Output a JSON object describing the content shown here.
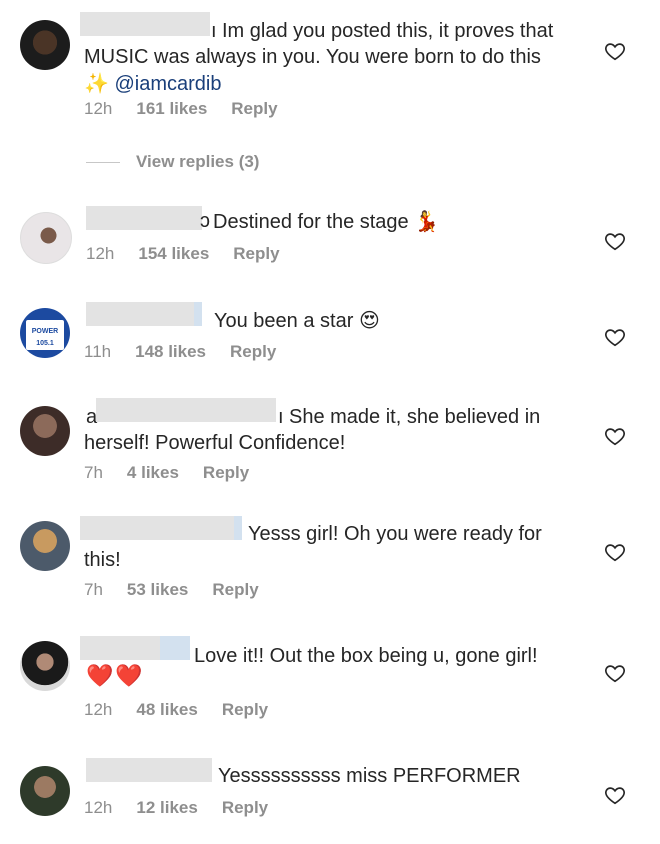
{
  "heart_icon": "heart-outline-icon",
  "colors": {
    "text": "#262626",
    "meta": "#8e8e8e",
    "mention": "#1a3f7a",
    "heart_red": "#e0253b"
  },
  "comments": [
    {
      "avatar": "avatar-1",
      "text": "Im glad you posted this, it proves that\nMUSIC was always in you. You were born to do this\n",
      "emoji": "✨",
      "mention": "@iamcardib",
      "time": "12h",
      "likes": "161 likes",
      "reply": "Reply",
      "view_replies": "View replies (3)"
    },
    {
      "avatar": "avatar-2",
      "text": "Destined for the stage",
      "emoji": "💃",
      "time": "12h",
      "likes": "154 likes",
      "reply": "Reply"
    },
    {
      "avatar": "avatar-3",
      "avatar_text": "POWER 105.1",
      "text": "You been a star",
      "emoji": "😍",
      "time": "11h",
      "likes": "148 likes",
      "reply": "Reply"
    },
    {
      "avatar": "avatar-4",
      "text": "She made it, she believed in\nherself! Powerful Confidence!",
      "time": "7h",
      "likes": "4 likes",
      "reply": "Reply"
    },
    {
      "avatar": "avatar-5",
      "text": "Yesss girl! Oh you were ready for\nthis!",
      "time": "7h",
      "likes": "53 likes",
      "reply": "Reply"
    },
    {
      "avatar": "avatar-6",
      "text": "Love it!! Out the box being u, gone girl!",
      "emoji": "❤️❤️",
      "time": "12h",
      "likes": "48 likes",
      "reply": "Reply"
    },
    {
      "avatar": "avatar-7",
      "text": "Yessssssssss miss PERFORMER",
      "time": "12h",
      "likes": "12 likes",
      "reply": "Reply"
    }
  ]
}
